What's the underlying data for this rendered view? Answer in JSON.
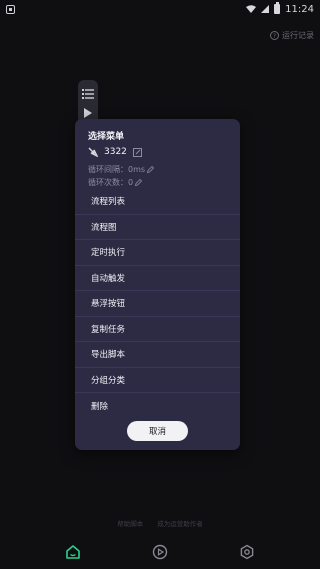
{
  "status_bar": {
    "time": "11:24"
  },
  "background": {
    "help_link": "运行记录",
    "footer_links": [
      "帮助脚本",
      "成为运营助作者"
    ]
  },
  "dialog": {
    "title": "选择菜单",
    "task": {
      "name": "3322"
    },
    "loop_interval": "循环间隔：0ms",
    "loop_count": "循环次数：0",
    "menu_items": [
      "流程列表",
      "流程图",
      "定时执行",
      "自动触发",
      "悬浮按钮",
      "复制任务",
      "导出脚本",
      "分组分类",
      "删除"
    ],
    "cancel_label": "取消"
  },
  "colors": {
    "background": "#0f0f12",
    "dialog_bg": "#2d2a44",
    "accent_green": "#2ecf8c"
  },
  "icons": {
    "status_left": "app-notification-icon",
    "task": "task-icon",
    "edit": "edit-icon",
    "nav": [
      "home-icon",
      "play-icon",
      "settings-icon"
    ]
  }
}
